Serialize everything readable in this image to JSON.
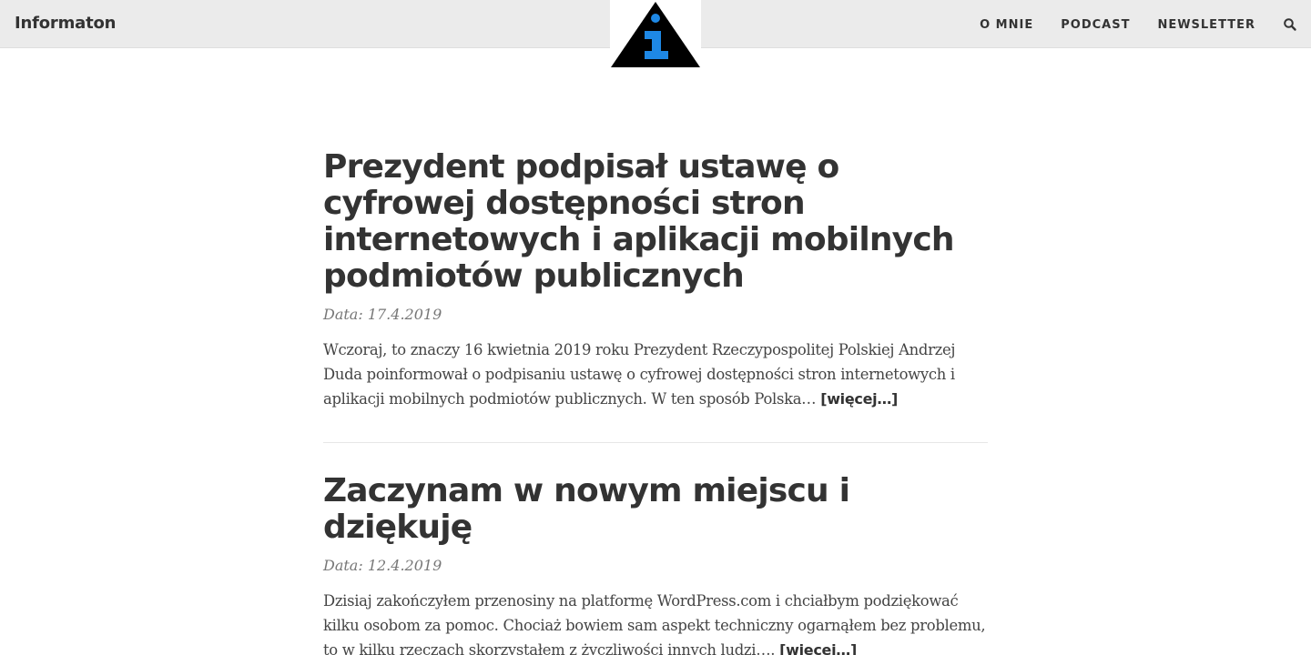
{
  "header": {
    "site_title": "Informaton",
    "logo_letter": "i",
    "nav": [
      "O MNIE",
      "PODCAST",
      "NEWSLETTER"
    ],
    "search_icon": "search-icon"
  },
  "posts": [
    {
      "title": "Prezydent podpisał ustawę o cyfrowej dostępności stron internetowych i aplikacji mobilnych podmiotów publicznych",
      "date": "Data: 17.4.2019",
      "excerpt": "Wczoraj, to znaczy 16 kwietnia 2019 roku Prezydent Rzeczypospolitej Polskiej Andrzej Duda poinformował o podpisaniu ustawę o cyfrowej dostępności stron internetowych i aplikacji mobilnych podmiotów publicznych. W ten sposób Polska… ",
      "more": "[więcej…]"
    },
    {
      "title": "Zaczynam w nowym miejscu i dziękuję",
      "date": "Data: 12.4.2019",
      "excerpt": "Dzisiaj zakończyłem przenosiny na platformę WordPress.com i chciałbym podziękować kilku osobom za pomoc. Chociaż bowiem sam aspekt techniczny ogarnąłem bez problemu, to w kilku rzeczach skorzystałem z życzliwości innych ludzi…. ",
      "more": "[więcej…]"
    }
  ],
  "colors": {
    "header_bg": "#ebebeb",
    "text": "#333333",
    "logo_accent": "#1e88e5"
  }
}
